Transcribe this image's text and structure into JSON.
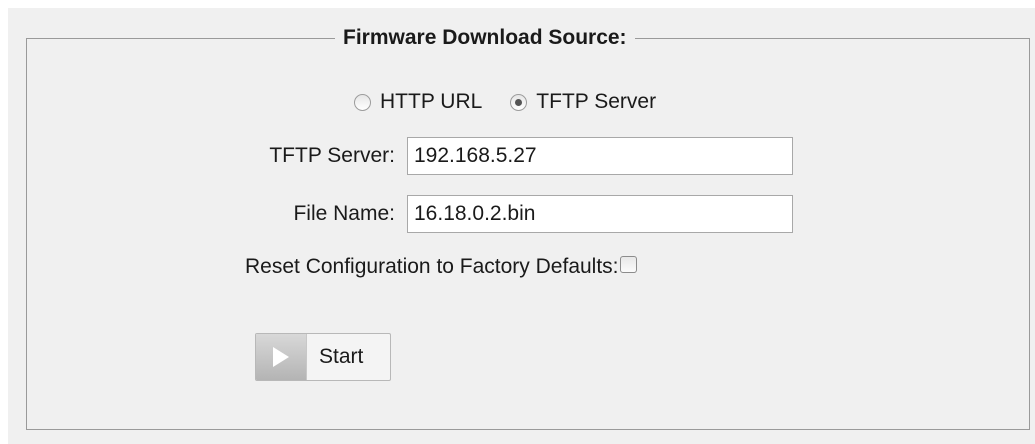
{
  "fieldset": {
    "legend": "Firmware Download Source:"
  },
  "source": {
    "options": [
      {
        "label": "HTTP URL",
        "selected": false
      },
      {
        "label": "TFTP Server",
        "selected": true
      }
    ]
  },
  "fields": {
    "tftp_server": {
      "label": "TFTP Server:",
      "value": "192.168.5.27"
    },
    "file_name": {
      "label": "File Name:",
      "value": "16.18.0.2.bin"
    },
    "reset_defaults": {
      "label": "Reset Configuration to Factory Defaults:",
      "checked": false
    }
  },
  "actions": {
    "start_label": "Start",
    "start_icon": "play-icon"
  },
  "colors": {
    "panel_background": "#f0f0f0",
    "border": "#9a9a9a"
  }
}
